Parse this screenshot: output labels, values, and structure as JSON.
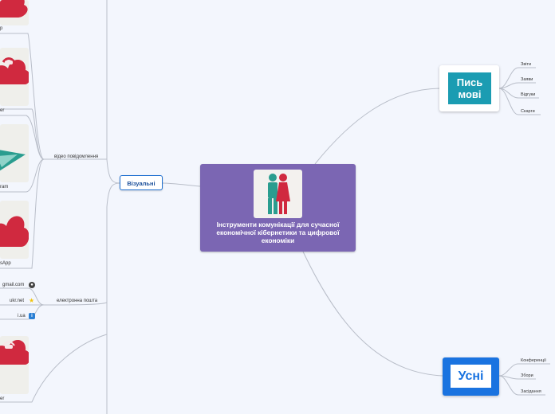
{
  "central": {
    "title": "Інструменти комунікації для сучасної економічної кібернетики та цифрової економіки",
    "image_icon": "people-couple-icon"
  },
  "branches": {
    "visual": {
      "label": "Візуальні"
    },
    "written": {
      "label": "Пись мові",
      "children": [
        "Звіти",
        "Заяви",
        "Відгуки",
        "Скарги"
      ]
    },
    "oral": {
      "label": "Усні",
      "children": [
        "Конференції",
        "Збори",
        "Засідання"
      ]
    }
  },
  "visual_children": {
    "video": {
      "label": "відео повідомлення"
    },
    "email": {
      "label": "електронна пошта"
    }
  },
  "partial_labels": {
    "p1": "p",
    "p2": "er",
    "p3": "ram",
    "p4": "sApp",
    "p5": "er"
  },
  "email_items": [
    {
      "label": "gmail.com",
      "icon": "globe-icon"
    },
    {
      "label": "ukr.net",
      "icon": "star-icon"
    },
    {
      "label": "i.ua",
      "icon": "info-icon"
    }
  ],
  "colors": {
    "central": "#7b66b3",
    "visual_border": "#1e6fd0",
    "written": "#1b9cb2",
    "oral": "#1a73e0",
    "cloud_red": "#d0293f",
    "telegram_teal": "#2a9d8f"
  }
}
